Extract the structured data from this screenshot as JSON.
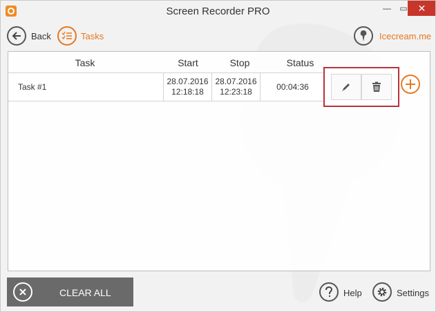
{
  "window": {
    "title": "Screen Recorder PRO",
    "minimize_glyph": "—",
    "maximize_glyph": "▭",
    "close_glyph": "✕"
  },
  "nav": {
    "back_label": "Back",
    "tasks_label": "Tasks",
    "brand_label": "Icecream.me"
  },
  "table": {
    "headers": {
      "task": "Task",
      "start": "Start",
      "stop": "Stop",
      "status": "Status"
    },
    "rows": [
      {
        "task": "Task #1",
        "start_date": "28.07.2016",
        "start_time": "12:18:18",
        "stop_date": "28.07.2016",
        "stop_time": "12:23:18",
        "status": "00:04:36"
      }
    ]
  },
  "footer": {
    "clear_all_label": "CLEAR ALL",
    "help_label": "Help",
    "settings_label": "Settings"
  },
  "colors": {
    "accent": "#e8771d",
    "highlight": "#b8323a",
    "close": "#c7352b",
    "clear_bg": "#6a6a6a"
  },
  "icons": [
    "app-icon",
    "back-arrow-icon",
    "tasks-list-icon",
    "icecream-icon",
    "pencil-icon",
    "trash-icon",
    "plus-icon",
    "close-x-icon",
    "question-icon",
    "gear-icon"
  ]
}
